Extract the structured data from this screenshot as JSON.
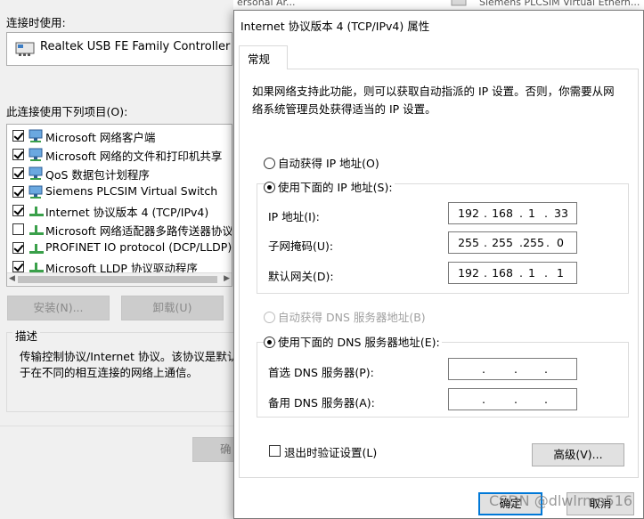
{
  "background_window": {
    "top_strip_left": "ersonal Ar...",
    "top_strip_right": "Siemens PLCSIM Virtual Ethern...",
    "connect_using_label": "连接时使用:",
    "adapter_name": "Realtek USB FE Family Controller",
    "items_label": "此连接使用下列项目(O):",
    "items": [
      {
        "label": "Microsoft 网络客户端",
        "checked": true,
        "icon": "network-client-icon"
      },
      {
        "label": "Microsoft 网络的文件和打印机共享",
        "checked": true,
        "icon": "network-client-icon"
      },
      {
        "label": "QoS 数据包计划程序",
        "checked": true,
        "icon": "network-client-icon"
      },
      {
        "label": "Siemens PLCSIM Virtual Switch",
        "checked": true,
        "icon": "network-client-icon"
      },
      {
        "label": "Internet 协议版本 4 (TCP/IPv4)",
        "checked": true,
        "icon": "protocol-icon"
      },
      {
        "label": "Microsoft 网络适配器多路传送器协议",
        "checked": false,
        "icon": "protocol-icon"
      },
      {
        "label": "PROFINET IO protocol (DCP/LLDP)",
        "checked": true,
        "icon": "protocol-icon"
      },
      {
        "label": "Microsoft LLDP 协议驱动程序",
        "checked": true,
        "icon": "protocol-icon"
      }
    ],
    "install_button": "安装(N)...",
    "uninstall_button": "卸载(U)",
    "description_title": "描述",
    "description_text_line1": "传输控制协议/Internet 协议。该协议是默认的",
    "description_text_line2": "于在不同的相互连接的网络上通信。",
    "ok_button_partial": "确"
  },
  "dialog": {
    "title": "Internet 协议版本 4 (TCP/IPv4) 属性",
    "tab_general": "常规",
    "description": "如果网络支持此功能，则可以获取自动指派的 IP 设置。否则，你需要从网络系统管理员处获得适当的 IP 设置。",
    "ip_auto_label": "自动获得 IP 地址(O)",
    "ip_manual_label": "使用下面的 IP 地址(S):",
    "ip_address_label": "IP 地址(I):",
    "subnet_label": "子网掩码(U):",
    "gateway_label": "默认网关(D):",
    "ip_address": [
      "192",
      "168",
      "1",
      "33"
    ],
    "subnet_mask": [
      "255",
      "255",
      "255",
      "0"
    ],
    "gateway": [
      "192",
      "168",
      "1",
      "1"
    ],
    "dns_auto_label": "自动获得 DNS 服务器地址(B)",
    "dns_manual_label": "使用下面的 DNS 服务器地址(E):",
    "preferred_dns_label": "首选 DNS 服务器(P):",
    "alternate_dns_label": "备用 DNS 服务器(A):",
    "preferred_dns": [
      "",
      "",
      "",
      ""
    ],
    "alternate_dns": [
      "",
      "",
      "",
      ""
    ],
    "validate_label": "退出时验证设置(L)",
    "advanced_button": "高级(V)...",
    "ok_button": "确定",
    "cancel_button": "取消"
  },
  "watermark": "CSDN @dlwlrma516"
}
